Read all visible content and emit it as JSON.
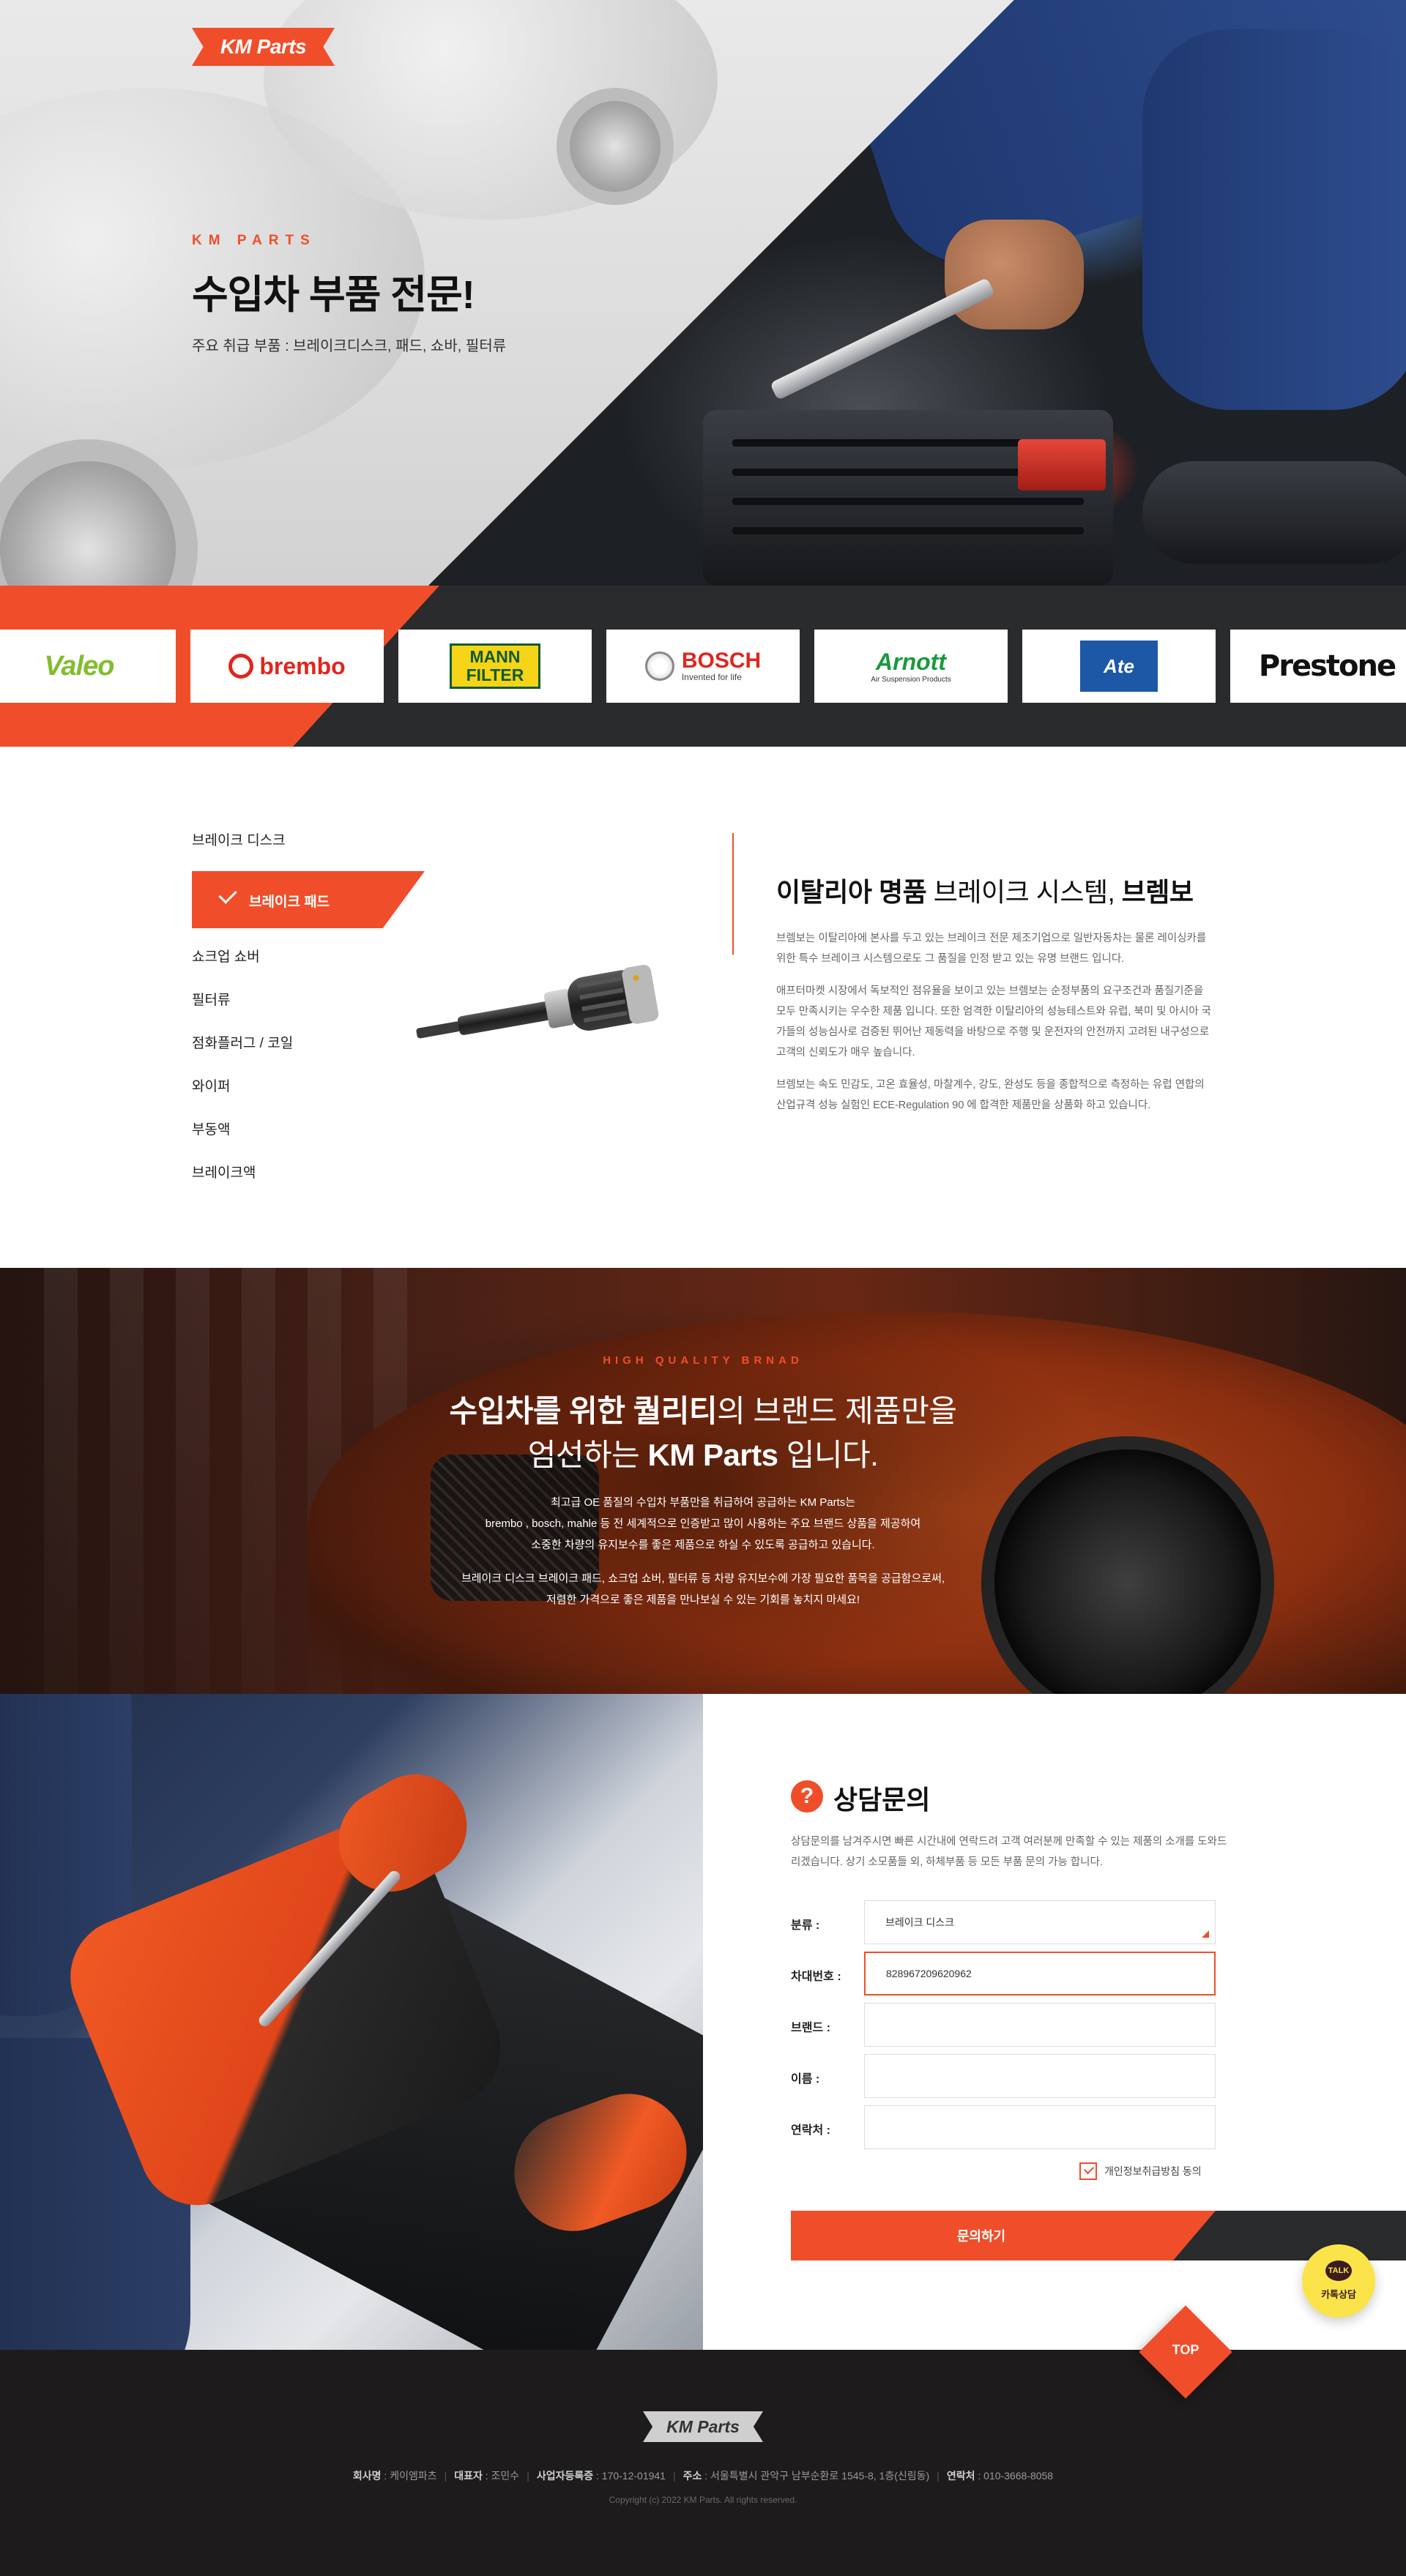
{
  "hero": {
    "logo": "KM Parts",
    "eyebrow": "KM PARTS",
    "title": "수입차 부품 전문!",
    "subtitle": "주요 취급 부품 : 브레이크디스크, 패드, 쇼바, 필터류"
  },
  "brands": [
    {
      "name": "Valeo",
      "color": "#82bd2d"
    },
    {
      "name": "brembo",
      "color": "#e0261d"
    },
    {
      "name": "MANN FILTER",
      "color": "#0f5b2f"
    },
    {
      "name": "BOSCH",
      "color": "#e0261d",
      "tagline": "Invented for life"
    },
    {
      "name": "Arnott",
      "color": "#189a3c",
      "tagline": "Air Suspension Products"
    },
    {
      "name": "Ate",
      "color": "#1c58a6"
    },
    {
      "name": "Prestone",
      "color": "#111111"
    }
  ],
  "categories": {
    "items": [
      "브레이크 디스크",
      "브레이크 패드",
      "쇼크업 쇼버",
      "필터류",
      "점화플러그 / 코일",
      "와이퍼",
      "부동액",
      "브레이크액"
    ],
    "active": "브레이크 패드"
  },
  "product": {
    "title_bold1": "이탈리아 명품",
    "title_light": "브레이크 시스템,",
    "title_bold2": "브렘보",
    "para1": "브렘보는 이탈리아에 본사를 두고 있는 브레이크 전문 제조기업으로 일반자동차는 물론 레이싱카를 위한 특수 브레이크 시스템으로도 그 품질을 인정 받고 있는 유명 브랜드 입니다.",
    "para2": "애프터마켓 시장에서 독보적인 점유율을 보이고 있는 브렘보는 순정부품의 요구조건과 품질기준을 모두 만족시키는 우수한 제품 입니다. 또한 엄격한 이탈리아의 성능테스트와 유럽, 북미 및 아시아 국가들의 성능심사로 검증된 뛰어난 제동력을 바탕으로 주행 및 운전자의 안전까지 고려된 내구성으로 고객의 신뢰도가 매우 높습니다.",
    "para3": "브렘보는 속도 민감도, 고온 효율성, 마찰계수, 강도, 완성도 등을 종합적으로 측정하는 유럽 연합의 산업규격 성능 실험인 ECE-Regulation 90 에 합격한 제품만을 상품화 하고 있습니다."
  },
  "story": {
    "eyebrow": "HIGH QUALITY BRNAD",
    "h1_bold": "수입차를 위한 퀄리티",
    "h1_light": "의 브랜드 제품만을",
    "h2_light1": "엄선하는",
    "h2_bold": "KM Parts",
    "h2_light2": "입니다.",
    "p1": "최고급 OE 품질의 수입차 부품만을 취급하여 공급하는 KM Parts는",
    "p2": "brembo , bosch, mahle 등 전 세계적으로 인증받고 많이 사용하는 주요 브랜드 상품을 제공하여",
    "p3": "소중한 차량의 유지보수를 좋은 제품으로 하실 수 있도록 공급하고 있습니다.",
    "p4": "브레이크 디스크 브레이크 패드, 쇼크업 쇼버, 필터류 등 차량 유지보수에 가장 필요한 품목을 공급함으로써,",
    "p5": "저렴한 가격으로 좋은 제품을 만나보실 수 있는 기회를 놓치지 마세요!"
  },
  "inquiry": {
    "icon": "?",
    "title": "상담문의",
    "desc": "상담문의를 남겨주시면 빠른 시간내에 연락드려 고객 여러분께 만족할 수 있는 제품의 소개를 도와드리겠습니다. 상기 소모품들 외, 하체부품 등 모든 부품 문의 가능 합니다.",
    "fields": [
      {
        "label": "분류 :",
        "value": "브레이크 디스크"
      },
      {
        "label": "차대번호 :",
        "value": "828967209620962"
      },
      {
        "label": "브랜드 :",
        "value": ""
      },
      {
        "label": "이름 :",
        "value": ""
      },
      {
        "label": "연락처 :",
        "value": ""
      }
    ],
    "agree": "개인정보취급방침 동의",
    "submit": "문의하기"
  },
  "floating": {
    "talk_badge": "TALK",
    "talk_label": "카톡상담",
    "top": "TOP"
  },
  "footer": {
    "logo": "KM Parts",
    "company_label": "회사명",
    "company": "케이엠파츠",
    "ceo_label": "대표자",
    "ceo": "조민수",
    "biz_label": "사업자등록증",
    "biz": "170-12-01941",
    "addr_label": "주소",
    "addr": "서울특별시 관악구 남부순환로 1545-8, 1층(신림동)",
    "tel_label": "연락처",
    "tel": "010-3668-8058",
    "copyright": "Copyright (c) 2022 KM Parts. All rights reserved."
  }
}
